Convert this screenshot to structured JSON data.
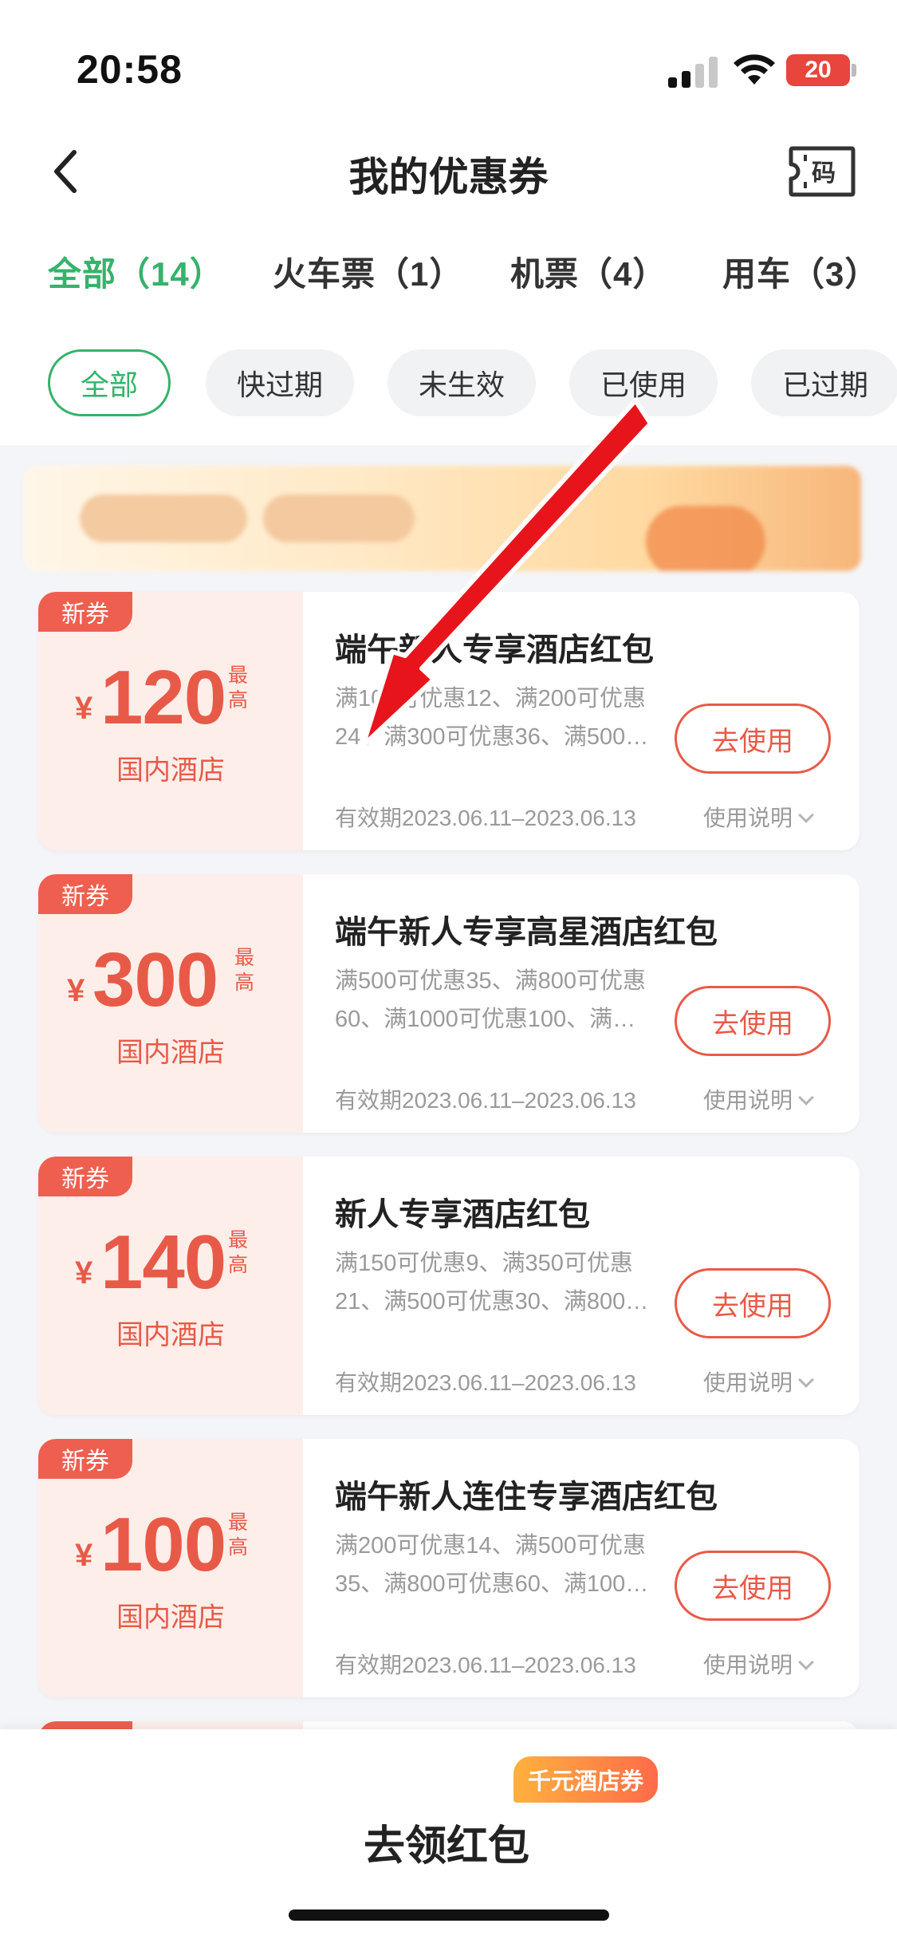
{
  "status_bar": {
    "time": "20:58",
    "battery": "20"
  },
  "header": {
    "back_icon": "chevron-left-icon",
    "title": "我的优惠券",
    "code_label": "码",
    "code_icon": "ticket-code-icon"
  },
  "tabs": [
    {
      "label": "全部（14）",
      "active": true
    },
    {
      "label": "火车票（1）",
      "active": false
    },
    {
      "label": "机票（4）",
      "active": false
    },
    {
      "label": "用车（3）",
      "active": false
    }
  ],
  "filters": [
    {
      "label": "全部",
      "active": true
    },
    {
      "label": "快过期",
      "active": false
    },
    {
      "label": "未生效",
      "active": false
    },
    {
      "label": "已使用",
      "active": false
    },
    {
      "label": "已过期",
      "active": false
    }
  ],
  "coupons": [
    {
      "badge": "新券",
      "currency": "¥",
      "amount": "120",
      "max_label": "最高",
      "category": "国内酒店",
      "title": "端午新人专享酒店红包",
      "description": "满100可优惠12、满200可优惠24、满300可优惠36、满500…",
      "button": "去使用",
      "validity": "有效期2023.06.11–2023.06.13",
      "usage": "使用说明"
    },
    {
      "badge": "新券",
      "currency": "¥",
      "amount": "300",
      "max_label": "最高",
      "category": "国内酒店",
      "title": "端午新人专享高星酒店红包",
      "description": "满500可优惠35、满800可优惠60、满1000可优惠100、满…",
      "button": "去使用",
      "validity": "有效期2023.06.11–2023.06.13",
      "usage": "使用说明"
    },
    {
      "badge": "新券",
      "currency": "¥",
      "amount": "140",
      "max_label": "最高",
      "category": "国内酒店",
      "title": "新人专享酒店红包",
      "description": "满150可优惠9、满350可优惠21、满500可优惠30、满800…",
      "button": "去使用",
      "validity": "有效期2023.06.11–2023.06.13",
      "usage": "使用说明"
    },
    {
      "badge": "新券",
      "currency": "¥",
      "amount": "100",
      "max_label": "最高",
      "category": "国内酒店",
      "title": "端午新人连住专享酒店红包",
      "description": "满200可优惠14、满500可优惠35、满800可优惠60、满100…",
      "button": "去使用",
      "validity": "有效期2023.06.11–2023.06.13",
      "usage": "使用说明"
    }
  ],
  "bottom": {
    "button": "去领红包",
    "promo": "千元酒店券"
  },
  "colors": {
    "accent_green": "#36b26b",
    "coupon_red": "#e85a48",
    "badge_red": "#ee5f4f",
    "arrow_red": "#e8141b"
  }
}
